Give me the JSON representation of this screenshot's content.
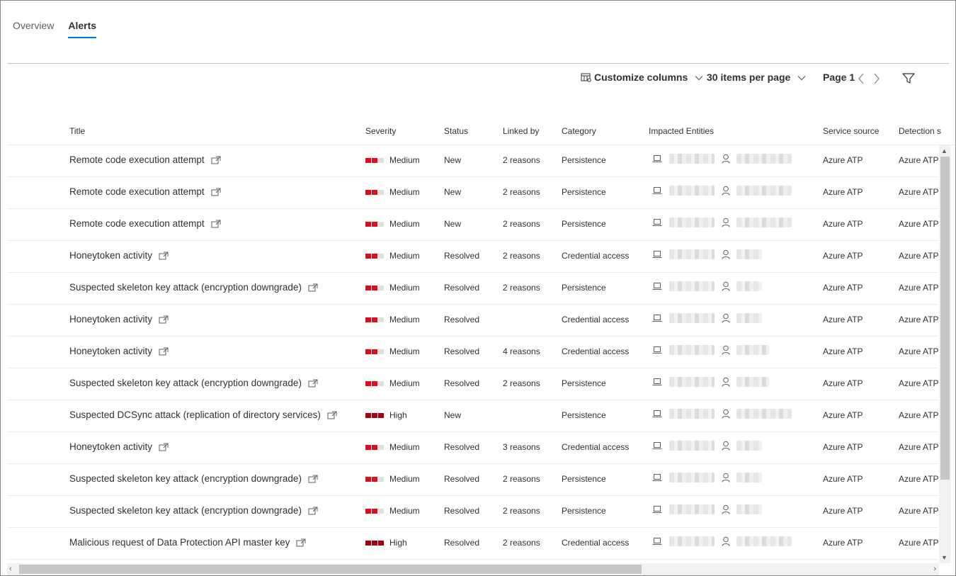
{
  "tabs": [
    {
      "label": "Overview",
      "active": false
    },
    {
      "label": "Alerts",
      "active": true
    }
  ],
  "toolbar": {
    "customize_label": "Customize columns",
    "per_page_label": "30 items per page",
    "page_label": "Page 1"
  },
  "columns": {
    "title": "Title",
    "severity": "Severity",
    "status": "Status",
    "linked_by": "Linked by",
    "category": "Category",
    "impacted_entities": "Impacted Entities",
    "service_source": "Service source",
    "detection_source": "Detection s"
  },
  "colors": {
    "accent": "#0078d4",
    "severity_medium": "#e00b1c",
    "severity_high": "#a4000f",
    "severity_empty": "#e1dfdd"
  },
  "rows": [
    {
      "title": "Remote code execution attempt",
      "severity": "Medium",
      "status": "New",
      "linked_by": "2 reasons",
      "category": "Persistence",
      "service_source": "Azure ATP",
      "detection_source": "Azure ATP"
    },
    {
      "title": "Remote code execution attempt",
      "severity": "Medium",
      "status": "New",
      "linked_by": "2 reasons",
      "category": "Persistence",
      "service_source": "Azure ATP",
      "detection_source": "Azure ATP"
    },
    {
      "title": "Remote code execution attempt",
      "severity": "Medium",
      "status": "New",
      "linked_by": "2 reasons",
      "category": "Persistence",
      "service_source": "Azure ATP",
      "detection_source": "Azure ATP"
    },
    {
      "title": "Honeytoken activity",
      "severity": "Medium",
      "status": "Resolved",
      "linked_by": "2 reasons",
      "category": "Credential access",
      "service_source": "Azure ATP",
      "detection_source": "Azure ATP"
    },
    {
      "title": "Suspected skeleton key attack (encryption downgrade)",
      "severity": "Medium",
      "status": "Resolved",
      "linked_by": "2 reasons",
      "category": "Persistence",
      "service_source": "Azure ATP",
      "detection_source": "Azure ATP"
    },
    {
      "title": "Honeytoken activity",
      "severity": "Medium",
      "status": "Resolved",
      "linked_by": "",
      "category": "Credential access",
      "service_source": "Azure ATP",
      "detection_source": "Azure ATP"
    },
    {
      "title": "Honeytoken activity",
      "severity": "Medium",
      "status": "Resolved",
      "linked_by": "4 reasons",
      "category": "Credential access",
      "service_source": "Azure ATP",
      "detection_source": "Azure ATP"
    },
    {
      "title": "Suspected skeleton key attack (encryption downgrade)",
      "severity": "Medium",
      "status": "Resolved",
      "linked_by": "2 reasons",
      "category": "Persistence",
      "service_source": "Azure ATP",
      "detection_source": "Azure ATP"
    },
    {
      "title": "Suspected DCSync attack (replication of directory services)",
      "severity": "High",
      "status": "New",
      "linked_by": "",
      "category": "Persistence",
      "service_source": "Azure ATP",
      "detection_source": "Azure ATP"
    },
    {
      "title": "Honeytoken activity",
      "severity": "Medium",
      "status": "Resolved",
      "linked_by": "3 reasons",
      "category": "Credential access",
      "service_source": "Azure ATP",
      "detection_source": "Azure ATP"
    },
    {
      "title": "Suspected skeleton key attack (encryption downgrade)",
      "severity": "Medium",
      "status": "Resolved",
      "linked_by": "2 reasons",
      "category": "Persistence",
      "service_source": "Azure ATP",
      "detection_source": "Azure ATP"
    },
    {
      "title": "Suspected skeleton key attack (encryption downgrade)",
      "severity": "Medium",
      "status": "Resolved",
      "linked_by": "2 reasons",
      "category": "Persistence",
      "service_source": "Azure ATP",
      "detection_source": "Azure ATP"
    },
    {
      "title": "Malicious request of Data Protection API master key",
      "severity": "High",
      "status": "Resolved",
      "linked_by": "2 reasons",
      "category": "Credential access",
      "service_source": "Azure ATP",
      "detection_source": "Azure ATP"
    }
  ]
}
